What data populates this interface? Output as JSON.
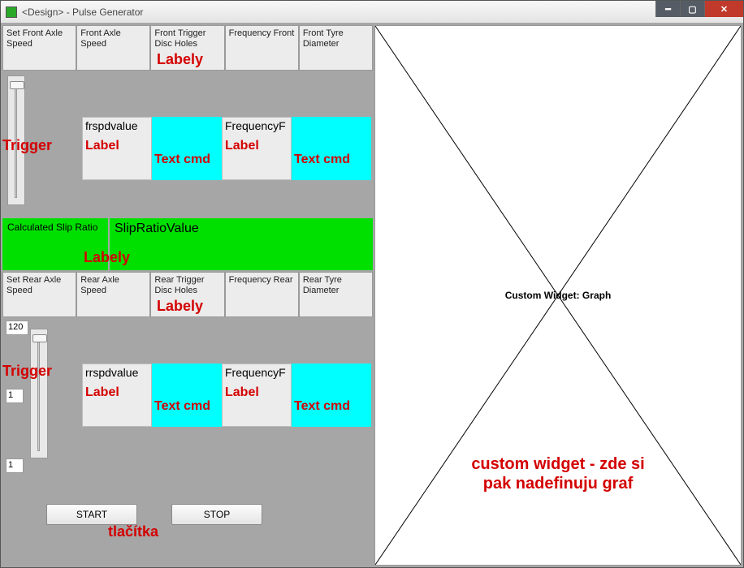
{
  "window": {
    "title": "<Design> - Pulse Generator"
  },
  "front": {
    "headers": {
      "set_speed": "Set Front Axle Speed",
      "axle_speed": "Front Axle Speed",
      "trigger_holes": "Front Trigger Disc Holes",
      "frequency": "Frequency Front",
      "tyre_diameter": "Front Tyre Diameter"
    },
    "blocks": {
      "spd_label": "frspdvalue",
      "freq_label": "FrequencyF",
      "textcmd1": "Text cmd",
      "textcmd2": "Text cmd"
    }
  },
  "slip": {
    "label": "Calculated Slip Ratio",
    "value": "SlipRatioValue"
  },
  "rear": {
    "headers": {
      "set_speed": "Set Rear Axle Speed",
      "axle_speed": "Rear Axle Speed",
      "trigger_holes": "Rear Trigger Disc Holes",
      "frequency": "Frequency Rear",
      "tyre_diameter": "Rear Tyre Diameter"
    },
    "blocks": {
      "spd_label": "rrspdvalue",
      "freq_label": "FrequencyF",
      "textcmd1": "Text cmd",
      "textcmd2": "Text cmd"
    },
    "num_top": "120",
    "num_mid": "1",
    "num_bot": "1"
  },
  "buttons": {
    "start": "START",
    "stop": "STOP"
  },
  "annotations": {
    "labely": "Labely",
    "trigger": "Trigger",
    "label": "Label",
    "tlacitka": "tlačítka",
    "custom_widget_1": "custom widget - zde si",
    "custom_widget_2": "pak nadefinuju graf"
  },
  "graph": {
    "placeholder": "Custom Widget: Graph"
  }
}
